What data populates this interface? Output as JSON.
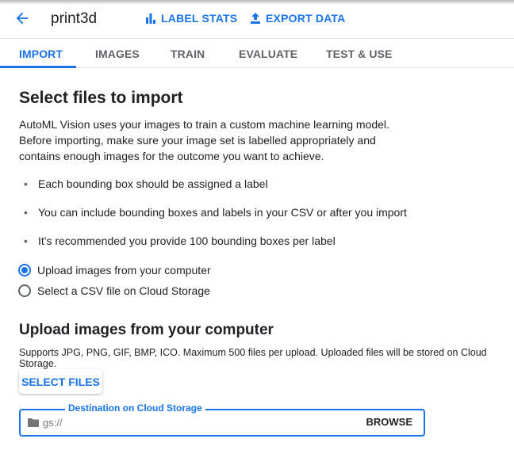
{
  "header": {
    "back_icon": "arrow-left-icon",
    "title": "print3d",
    "label_stats": {
      "icon": "bar-chart-icon",
      "label": "LABEL STATS"
    },
    "export_data": {
      "icon": "upload-icon",
      "label": "EXPORT DATA"
    }
  },
  "tabs": [
    {
      "label": "IMPORT",
      "active": true
    },
    {
      "label": "IMAGES",
      "active": false
    },
    {
      "label": "TRAIN",
      "active": false
    },
    {
      "label": "EVALUATE",
      "active": false
    },
    {
      "label": "TEST & USE",
      "active": false
    }
  ],
  "main": {
    "heading": "Select files to import",
    "intro": "AutoML Vision uses your images to train a custom machine learning model. Before importing, make sure your image set is labelled appropriately and contains enough images for the outcome you want to achieve.",
    "bullets": [
      "Each bounding box should be assigned a label",
      "You can include bounding boxes and labels in your CSV or after you import",
      "It's recommended you provide 100 bounding boxes per label"
    ],
    "radio_options": [
      {
        "label": "Upload images from your computer",
        "checked": true
      },
      {
        "label": "Select a CSV file on Cloud Storage",
        "checked": false
      }
    ],
    "upload": {
      "heading": "Upload images from your computer",
      "supports": "Supports JPG, PNG, GIF, BMP, ICO. Maximum 500 files per upload. Uploaded files will be stored on Cloud Storage.",
      "select_files_label": "SELECT FILES",
      "destination": {
        "label": "Destination on Cloud Storage",
        "icon": "folder-icon",
        "placeholder": "gs://",
        "value": "",
        "browse_label": "BROWSE"
      }
    }
  },
  "colors": {
    "accent": "#1a73e8",
    "text": "#202124",
    "muted": "#5f6368"
  }
}
